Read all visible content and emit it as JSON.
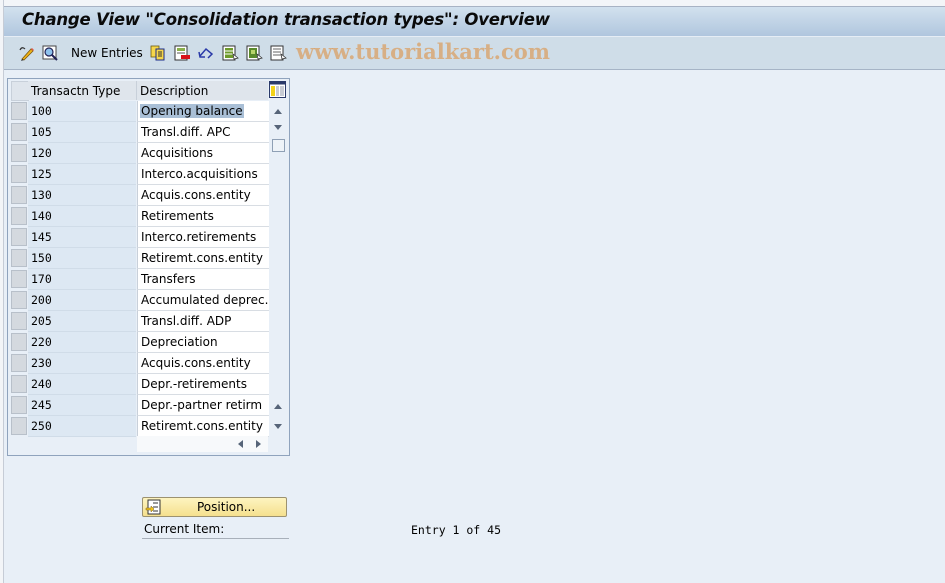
{
  "window": {
    "title": "Change View \"Consolidation transaction types\": Overview"
  },
  "toolbar": {
    "buttons": [
      {
        "icon": "display-change-icon"
      },
      {
        "icon": "other-view-icon"
      },
      {
        "label": "New Entries"
      },
      {
        "icon": "copy-as-icon"
      },
      {
        "icon": "delete-icon"
      },
      {
        "icon": "undo-change-icon"
      },
      {
        "icon": "select-all-icon"
      },
      {
        "icon": "select-block-icon"
      },
      {
        "icon": "deselect-all-icon"
      }
    ],
    "new_entries_label": "New Entries",
    "watermark": "www.tutorialkart.com"
  },
  "table": {
    "columns": [
      "Transactn Type",
      "Description"
    ],
    "rows": [
      {
        "type": "100",
        "description": "Opening balance",
        "selected": true
      },
      {
        "type": "105",
        "description": "Transl.diff. APC"
      },
      {
        "type": "120",
        "description": "Acquisitions"
      },
      {
        "type": "125",
        "description": "Interco.acquisitions"
      },
      {
        "type": "130",
        "description": "Acquis.cons.entity"
      },
      {
        "type": "140",
        "description": "Retirements"
      },
      {
        "type": "145",
        "description": "Interco.retirements"
      },
      {
        "type": "150",
        "description": "Retiremt.cons.entity"
      },
      {
        "type": "170",
        "description": "Transfers"
      },
      {
        "type": "200",
        "description": "Accumulated deprec."
      },
      {
        "type": "205",
        "description": "Transl.diff. ADP"
      },
      {
        "type": "220",
        "description": "Depreciation"
      },
      {
        "type": "230",
        "description": "Acquis.cons.entity"
      },
      {
        "type": "240",
        "description": "Depr.-retirements"
      },
      {
        "type": "245",
        "description": "Depr.-partner retirm"
      },
      {
        "type": "250",
        "description": "Retiremt.cons.entity"
      }
    ]
  },
  "footer": {
    "position_button_label": "Position...",
    "current_item_label": "Current Item:",
    "entry_text": "Entry 1 of 45"
  },
  "colors": {
    "title_bar_top": "#d2e1ee",
    "title_bar_bottom": "#b0c6de",
    "toolbar_bg": "#cfdde8",
    "page_bg": "#e8eff7",
    "key_column_bg": "#dde8f3",
    "selection_highlight": "#a9bfd6",
    "position_button": "#f5e08e",
    "watermark": "#dc9650"
  }
}
